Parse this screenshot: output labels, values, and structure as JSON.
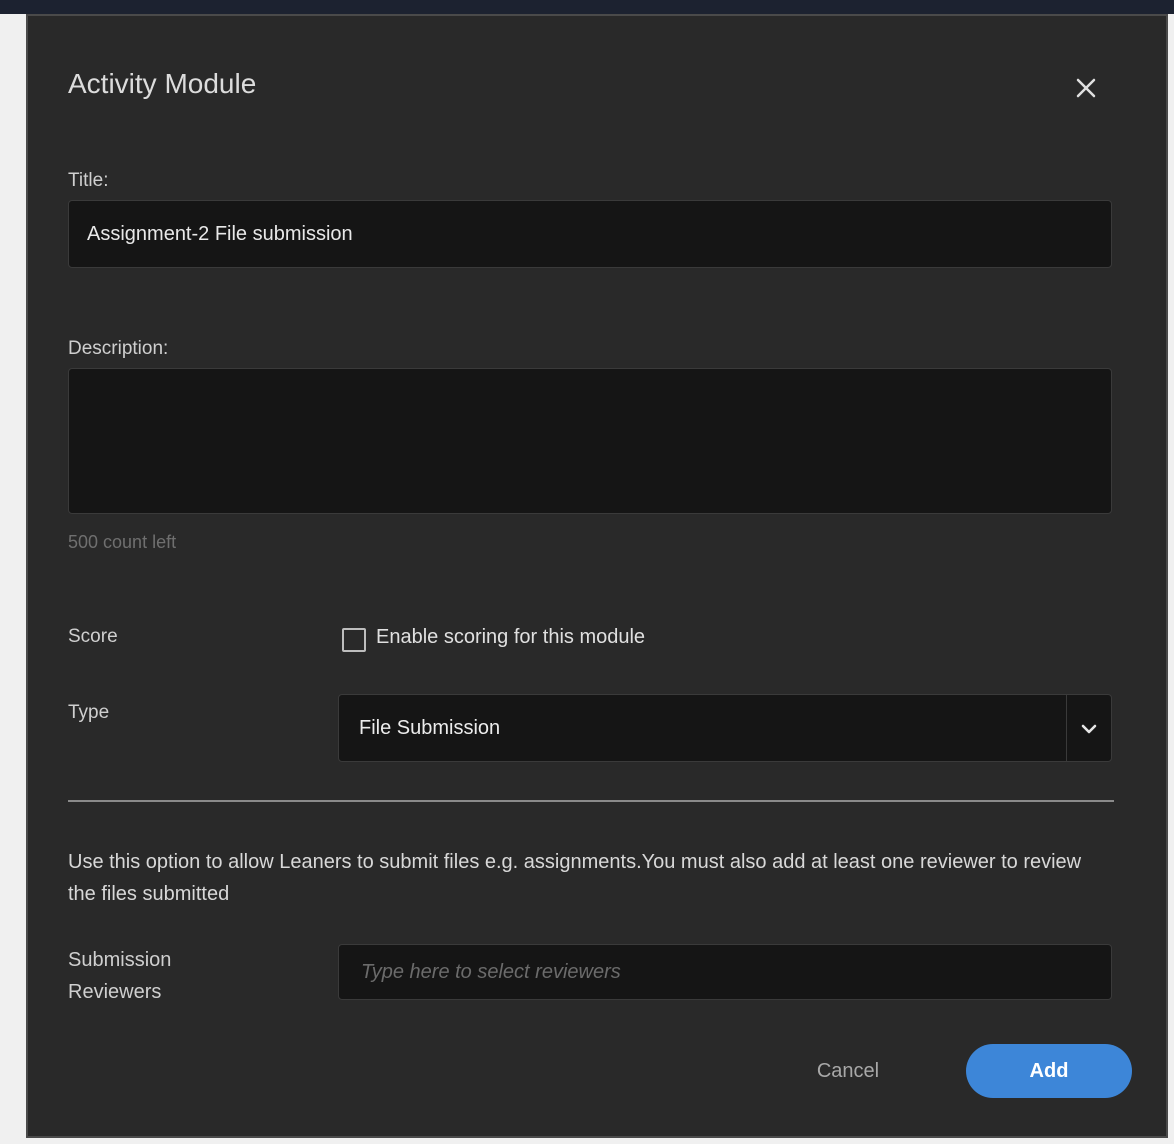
{
  "modal": {
    "title": "Activity Module"
  },
  "form": {
    "title_label": "Title:",
    "title_value": "Assignment-2 File submission",
    "description_label": "Description:",
    "description_value": "",
    "description_counter": "500 count left",
    "score_label": "Score",
    "score_checkbox_label": "Enable scoring for this module",
    "score_checked": false,
    "type_label": "Type",
    "type_selected": "File Submission",
    "help_text": "Use this option to allow Leaners to submit files e.g. assignments.You must also add at least one reviewer to review the files submitted",
    "reviewers_label": "Submission Reviewers",
    "reviewers_placeholder": "Type here to select reviewers"
  },
  "footer": {
    "cancel_label": "Cancel",
    "add_label": "Add"
  },
  "colors": {
    "modal_bg": "#292929",
    "input_bg": "#151515",
    "accent": "#3d86d8"
  },
  "icons": {
    "close": "close-icon",
    "chevron": "chevron-down-icon"
  }
}
